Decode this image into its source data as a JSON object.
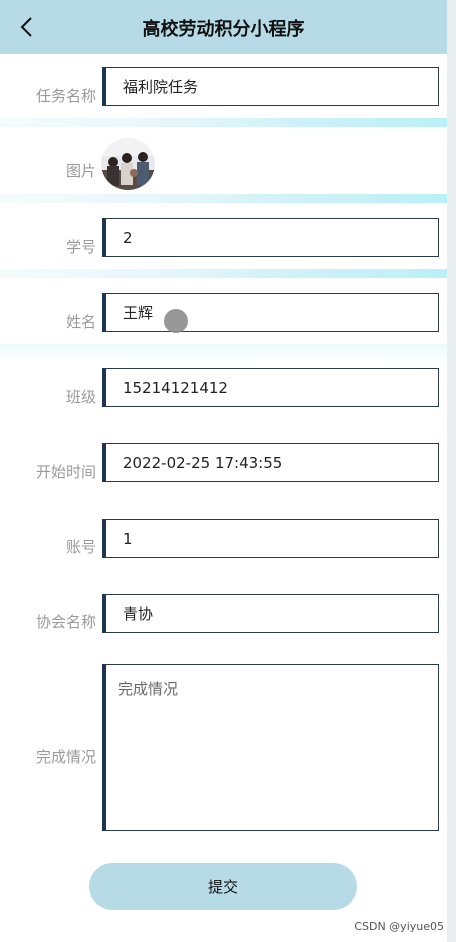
{
  "nav": {
    "back_icon": "chevron-left-icon",
    "title": "高校劳动积分小程序"
  },
  "form": {
    "task_name": {
      "label": "任务名称",
      "value": "福利院任务"
    },
    "image": {
      "label": "图片"
    },
    "student_id": {
      "label": "学号",
      "value": "2"
    },
    "name": {
      "label": "姓名",
      "value": "王辉"
    },
    "class": {
      "label": "班级",
      "value": "15214121412"
    },
    "start_time": {
      "label": "开始时间",
      "value": "2022-02-25 17:43:55"
    },
    "account": {
      "label": "账号",
      "value": "1"
    },
    "association": {
      "label": "协会名称",
      "value": "青协"
    },
    "completion": {
      "label": "完成情况",
      "placeholder": "完成情况"
    }
  },
  "submit_label": "提交",
  "watermark": "CSDN @yiyue05",
  "colors": {
    "nav_bg": "#b7dbe6",
    "field_border": "#1d3550",
    "label": "#9a9a9a"
  }
}
